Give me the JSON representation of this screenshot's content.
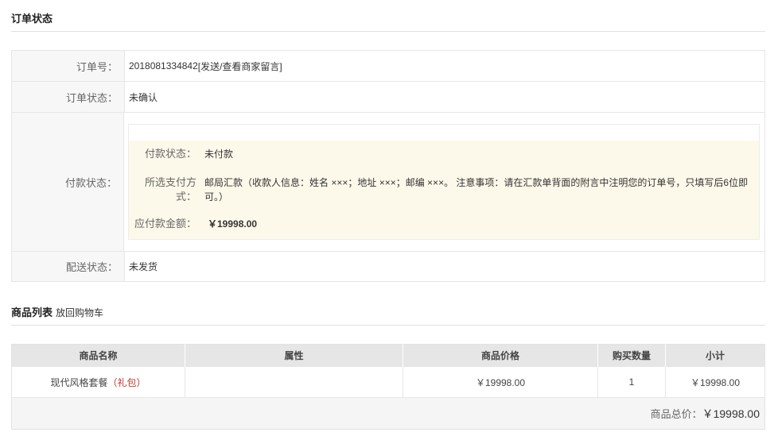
{
  "order_section": {
    "title": "订单状态"
  },
  "order": {
    "order_no_label": "订单号：",
    "order_no": "2018081334842",
    "message_link": "[发送/查看商家留言]",
    "order_status_label": "订单状态：",
    "order_status": "未确认",
    "payment_status_label": "付款状态：",
    "payment": {
      "status_key": "付款状态：",
      "status_value": "未付款",
      "method_key": "所选支付方式：",
      "method_value": "邮局汇款（收款人信息：姓名 ×××；地址 ×××；邮编 ×××。 注意事项：请在汇款单背面的附言中注明您的订单号，只填写后6位即可。）",
      "amount_key": "应付款金额：",
      "amount_value": "￥19998.00"
    },
    "shipping_status_label": "配送状态：",
    "shipping_status": "未发货"
  },
  "goods_section": {
    "title": "商品列表",
    "back_link": "放回购物车"
  },
  "goods_table": {
    "headers": [
      "商品名称",
      "属性",
      "商品价格",
      "购买数量",
      "小计"
    ],
    "rows": [
      {
        "name": "现代风格套餐",
        "tag": "（礼包）",
        "attr": "",
        "price": "￥19998.00",
        "qty": "1",
        "subtotal": "￥19998.00"
      }
    ],
    "total_label": "商品总价：",
    "total_value": "￥19998.00"
  }
}
